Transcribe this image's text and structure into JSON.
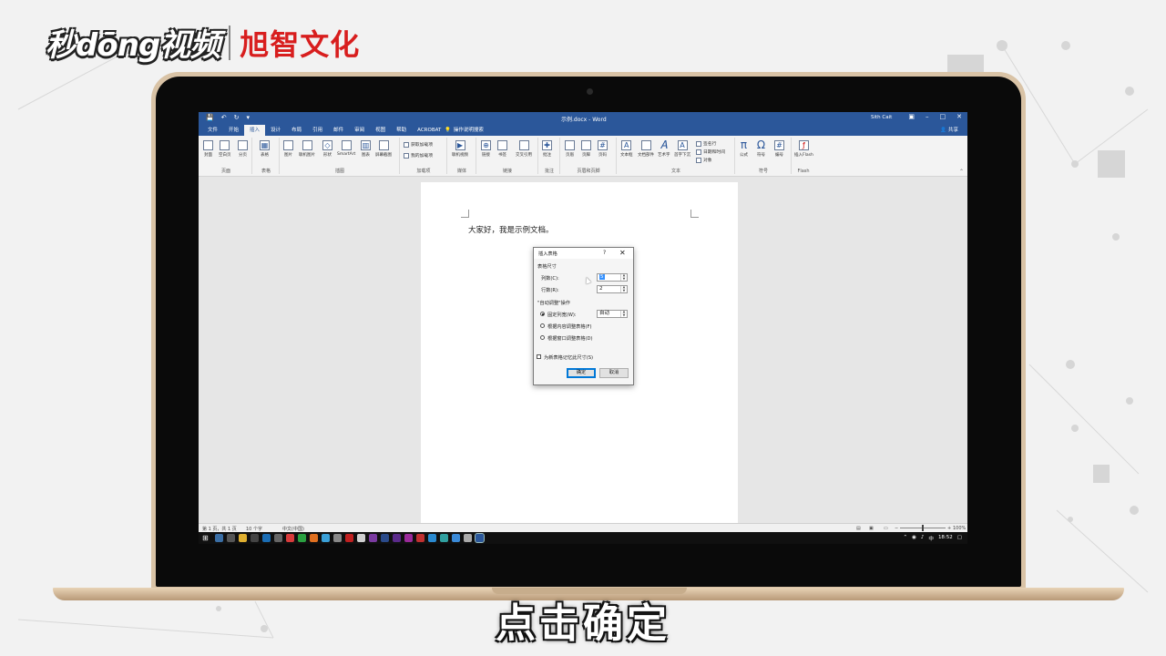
{
  "brand": {
    "left": "秒dōng视频",
    "right": "旭智文化"
  },
  "caption": "点击确定",
  "word": {
    "titlebar": {
      "doc_title": "示例.docx - Word",
      "user": "Sith Cait"
    },
    "tabs": [
      "文件",
      "开始",
      "插入",
      "设计",
      "布局",
      "引用",
      "邮件",
      "审阅",
      "视图",
      "帮助",
      "ACROBAT"
    ],
    "active_tab": "插入",
    "tell_me": "操作说明搜索",
    "share": "共享",
    "ribbon": {
      "groups": {
        "pages": "页面",
        "tables": "表格",
        "illustrations": "插图",
        "addins": "加载项",
        "media": "媒体",
        "links": "链接",
        "comments": "批注",
        "header_footer": "页眉和页脚",
        "text": "文本",
        "symbols": "符号",
        "flash": "Flash"
      },
      "items": {
        "cover": "封面",
        "blank_page": "空白页",
        "page_break": "分页",
        "table": "表格",
        "picture": "图片",
        "online_picture": "联机图片",
        "shapes": "形状",
        "smartart": "SmartArt",
        "chart": "图表",
        "screenshot": "屏幕截图",
        "get_addins": "获取加载项",
        "my_addins": "我的加载项",
        "online_video": "联机视频",
        "link": "链接",
        "bookmark": "书签",
        "cross_ref": "交叉引用",
        "comment": "批注",
        "header": "页眉",
        "footer": "页脚",
        "page_number": "页码",
        "textbox": "文本框",
        "quick_parts": "文档部件",
        "wordart": "艺术字",
        "dropcap": "首字下沉",
        "signature": "签名行",
        "datetime": "日期和时间",
        "object": "对象",
        "equation": "公式",
        "symbol": "符号",
        "number": "编号",
        "insert_flash": "插入Flash"
      }
    },
    "document": {
      "text": "大家好，我是示例文档。"
    },
    "status": {
      "page": "第 1 页，共 1 页",
      "words": "10 个字",
      "lang": "中文(中国)",
      "zoom": "100%"
    },
    "taskbar": {
      "lang": "中",
      "time": "18:52"
    }
  },
  "dialog": {
    "title": "插入表格",
    "help": "?",
    "close": "✕",
    "section_size": "表格尺寸",
    "cols_label": "列数(C):",
    "cols_value": "5",
    "rows_label": "行数(R):",
    "rows_value": "2",
    "section_autofit": "\"自动调整\"操作",
    "fixed_label": "固定列宽(W):",
    "fixed_value": "自动",
    "autofit_content": "根据内容调整表格(F)",
    "autofit_window": "根据窗口调整表格(D)",
    "remember": "为新表格记忆此尺寸(S)",
    "ok": "确定",
    "cancel": "取消"
  }
}
